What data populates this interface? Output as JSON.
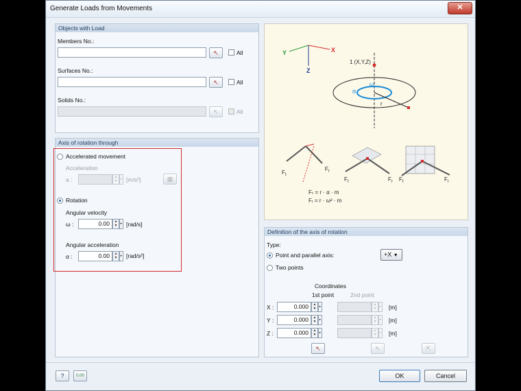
{
  "window": {
    "title": "Generate Loads from Movements",
    "close_glyph": "✕"
  },
  "objects": {
    "header": "Objects with Load",
    "members_label": "Members No.:",
    "surfaces_label": "Surfaces No.:",
    "solids_label": "Solids No.:",
    "all_label": "All"
  },
  "axis": {
    "header": "Axis of rotation through",
    "accelerated_label": "Accelerated movement",
    "acceleration_label": "Acceleration",
    "a_symbol": "a :",
    "a_unit": "[m/s²]",
    "rotation_label": "Rotation",
    "angular_velocity_label": "Angular velocity",
    "omega_symbol": "ω :",
    "omega_value": "0.00",
    "omega_unit": "[rad/s]",
    "angular_accel_label": "Angular acceleration",
    "alpha_symbol": "α :",
    "alpha_value": "0.00",
    "alpha_unit": "[rad/s²]"
  },
  "diagram": {
    "axis_x": "X",
    "axis_y": "Y",
    "axis_z": "Z",
    "point_label": "1 (X,Y,Z)",
    "alpha": "α",
    "omega": "ω",
    "r": "r",
    "ft": "F",
    "ft_sub": "t",
    "fr": "F",
    "fr_sub": "r",
    "formula1": "Fₜ = r · α · m",
    "formula2": "Fᵣ = r · ω² · m"
  },
  "definition": {
    "header": "Definition of the axis of rotation",
    "type_label": "Type:",
    "point_parallel_label": "Point and parallel axis:",
    "axis_select": "+X",
    "two_points_label": "Two points",
    "coordinates_label": "Coordinates",
    "first_point_label": "1st point",
    "second_point_label": "2nd point",
    "rows": [
      {
        "axis": "X :",
        "value": "0.000",
        "unit": "[m]"
      },
      {
        "axis": "Y :",
        "value": "0.000",
        "unit": "[m]"
      },
      {
        "axis": "Z :",
        "value": "0.000",
        "unit": "[m]"
      }
    ]
  },
  "footer": {
    "help_icon": "?",
    "units_icon": "0.00",
    "ok_label": "OK",
    "cancel_label": "Cancel"
  },
  "colors": {
    "accent": "#1f5fa8",
    "highlight": "#d42c2c",
    "diagram_bg": "#fdf9e9"
  }
}
